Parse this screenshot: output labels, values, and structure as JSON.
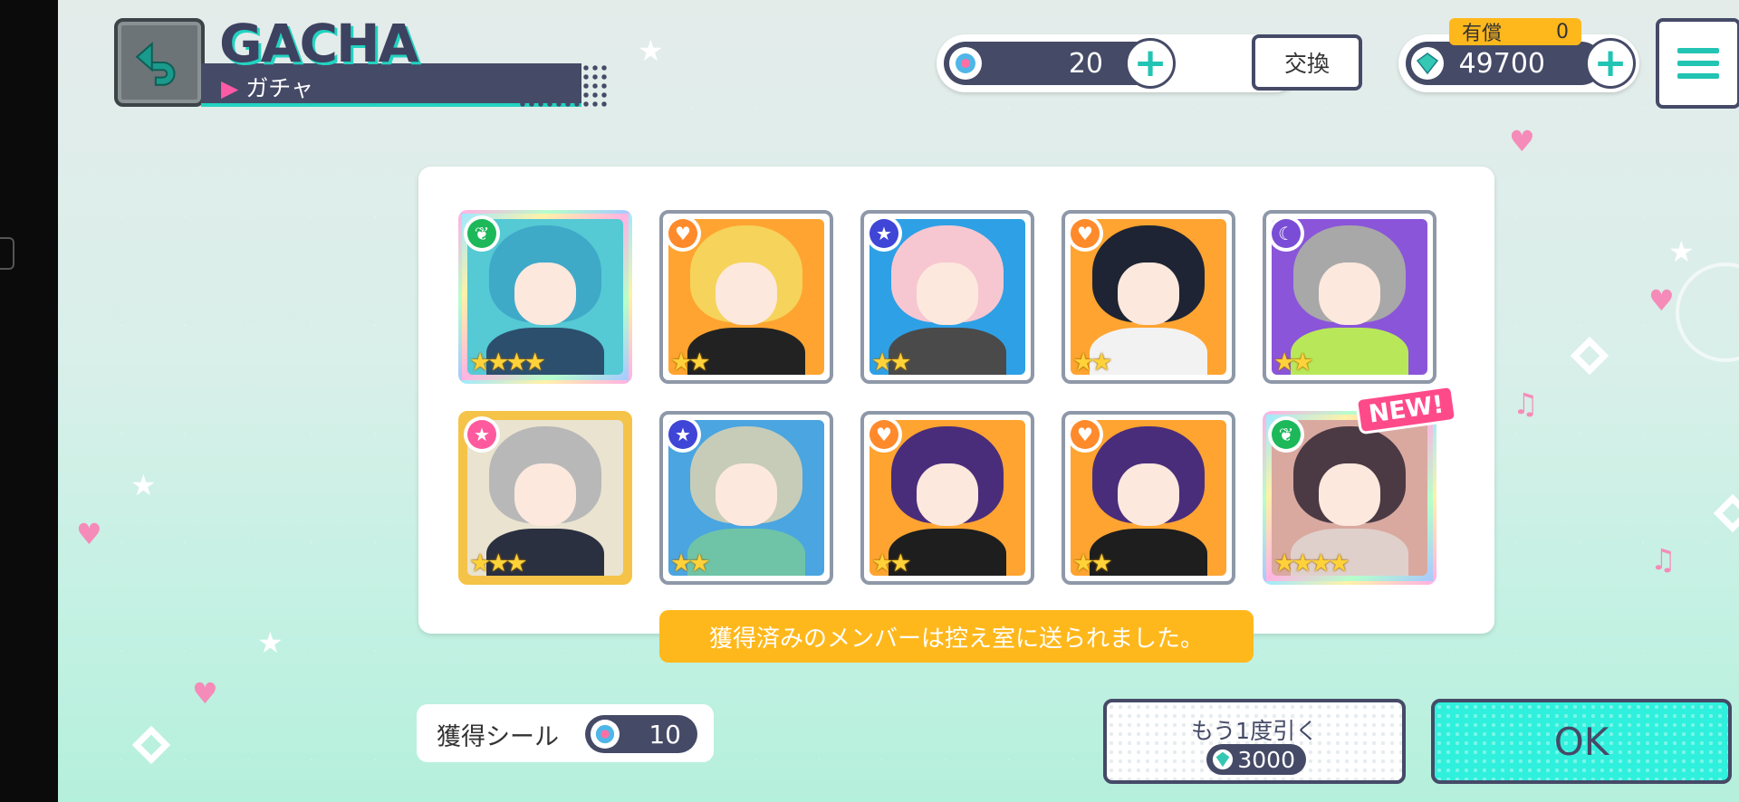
{
  "header": {
    "title": "GACHA",
    "subtitle": "ガチャ"
  },
  "currency": {
    "seal_count": "20",
    "exchange_label": "交換",
    "paid_label": "有償",
    "paid_count": "0",
    "gems": "49700"
  },
  "cards": [
    {
      "attribute": "pure",
      "attr_icon": "sprout-icon",
      "attr_color": "#1cb85a",
      "stars": 4,
      "frame": "rainbow",
      "hair": "#3fa9c8",
      "bg": "#55c9d4",
      "outfit": "#2c4f6e",
      "is_new": false
    },
    {
      "attribute": "happy",
      "attr_icon": "heart-icon",
      "attr_color": "#ff8a2b",
      "stars": 2,
      "frame": "silver",
      "hair": "#f6d35a",
      "bg": "#ffa431",
      "outfit": "#222222",
      "is_new": false
    },
    {
      "attribute": "cool",
      "attr_icon": "star-icon",
      "attr_color": "#3f45d6",
      "stars": 2,
      "frame": "silver",
      "hair": "#f7c7d1",
      "bg": "#2ea0e6",
      "outfit": "#4a4a4a",
      "is_new": false
    },
    {
      "attribute": "happy",
      "attr_icon": "heart-icon",
      "attr_color": "#ff8a2b",
      "stars": 2,
      "frame": "silver",
      "hair": "#1e2433",
      "bg": "#ffa431",
      "outfit": "#f2f2f2",
      "is_new": false
    },
    {
      "attribute": "mysterious",
      "attr_icon": "moon-icon",
      "attr_color": "#7a4dd6",
      "stars": 2,
      "frame": "silver",
      "hair": "#a8a8a8",
      "bg": "#8a55d9",
      "outfit": "#b8e85a",
      "is_new": false
    },
    {
      "attribute": "cute",
      "attr_icon": "star-icon",
      "attr_color": "#ff5a9e",
      "stars": 3,
      "frame": "gold",
      "hair": "#b8b8b8",
      "bg": "#e9e3d0",
      "outfit": "#2a3040",
      "is_new": false
    },
    {
      "attribute": "cool",
      "attr_icon": "star-icon",
      "attr_color": "#3f45d6",
      "stars": 2,
      "frame": "silver",
      "hair": "#c6ccb8",
      "bg": "#4aa5e0",
      "outfit": "#6fc4a8",
      "is_new": false
    },
    {
      "attribute": "happy",
      "attr_icon": "heart-icon",
      "attr_color": "#ff8a2b",
      "stars": 2,
      "frame": "silver",
      "hair": "#4a2d7a",
      "bg": "#ffa431",
      "outfit": "#1e1e1e",
      "is_new": false
    },
    {
      "attribute": "happy",
      "attr_icon": "heart-icon",
      "attr_color": "#ff8a2b",
      "stars": 2,
      "frame": "silver",
      "hair": "#4a2d7a",
      "bg": "#ffa431",
      "outfit": "#1e1e1e",
      "is_new": false
    },
    {
      "attribute": "pure",
      "attr_icon": "sprout-icon",
      "attr_color": "#1cb85a",
      "stars": 4,
      "frame": "rainbow",
      "hair": "#4b3a44",
      "bg": "#d9a9a0",
      "outfit": "#e0d0cc",
      "is_new": true
    }
  ],
  "new_badge": "NEW!",
  "notice": "獲得済みのメンバーは控え室に送られました。",
  "seal_reward": {
    "label": "獲得シール",
    "count": "10"
  },
  "pull_again": {
    "label": "もう1度引く",
    "cost": "3000"
  },
  "ok_label": "OK",
  "colors": {
    "navy": "#454a67",
    "teal": "#22c4b3",
    "accent_yellow": "#ffb81c",
    "new_pink": "#ff4a8a"
  }
}
